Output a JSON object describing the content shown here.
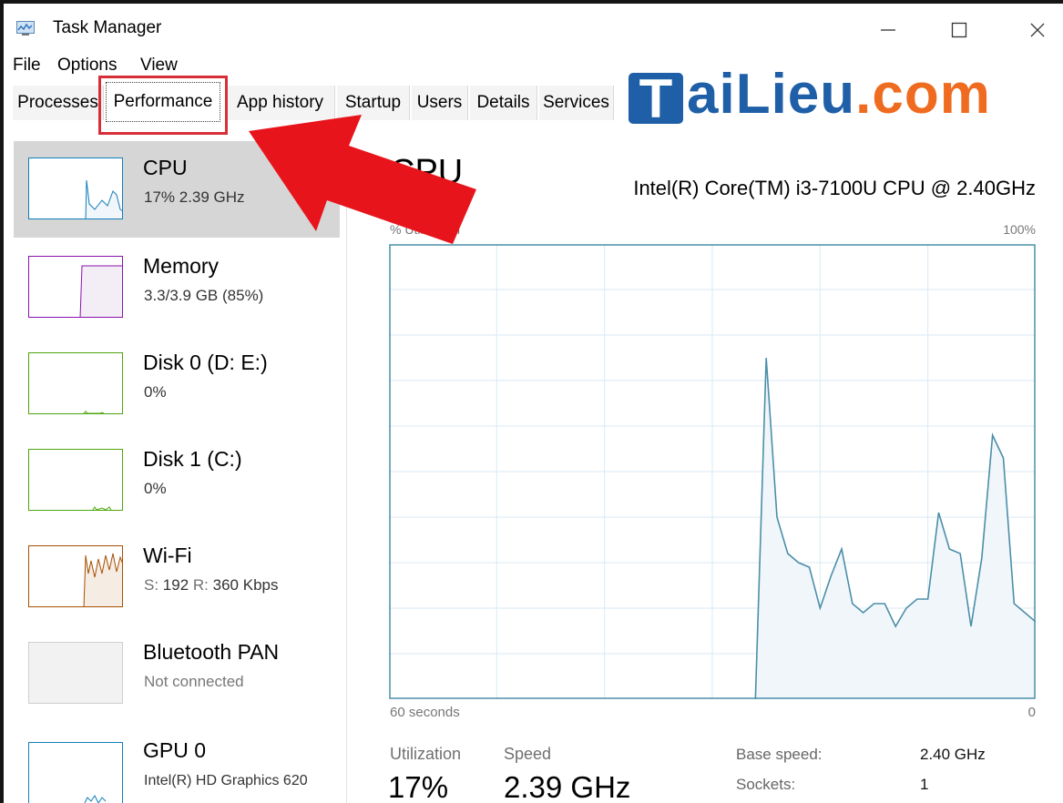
{
  "window": {
    "title": "Task Manager",
    "icons": {
      "app": "task-manager-icon",
      "minimize": "minimize-icon",
      "maximize": "maximize-icon",
      "close": "close-icon"
    }
  },
  "menu": [
    "File",
    "Options",
    "View"
  ],
  "tabs": [
    {
      "label": "Processes",
      "active": false
    },
    {
      "label": "Performance",
      "active": true
    },
    {
      "label": "App history",
      "active": false
    },
    {
      "label": "Startup",
      "active": false
    },
    {
      "label": "Users",
      "active": false
    },
    {
      "label": "Details",
      "active": false
    },
    {
      "label": "Services",
      "active": false
    }
  ],
  "watermark": {
    "text_T": "T",
    "text_blue": "aiLieu",
    "text_orange": ".com"
  },
  "sidebar": {
    "items": [
      {
        "name": "CPU",
        "sub": "17% 2.39 GHz",
        "selected": true,
        "color": "#117dbb"
      },
      {
        "name": "Memory",
        "sub": "3.3/3.9 GB (85%)",
        "selected": false,
        "color": "#8b12ae"
      },
      {
        "name": "Disk 0 (D: E:)",
        "sub": "0%",
        "selected": false,
        "color": "#4da60c"
      },
      {
        "name": "Disk 1 (C:)",
        "sub": "0%",
        "selected": false,
        "color": "#4da60c"
      },
      {
        "name": "Wi-Fi",
        "sub_s_label": "S:",
        "sub_s_value": "192",
        "sub_r_label": "R:",
        "sub_r_value": "360 Kbps",
        "selected": false,
        "color": "#a74f01"
      },
      {
        "name": "Bluetooth PAN",
        "sub": "Not connected",
        "selected": false,
        "color": "#999999"
      },
      {
        "name": "GPU 0",
        "sub": "Intel(R) HD Graphics 620",
        "selected": false,
        "color": "#117dbb"
      }
    ]
  },
  "main": {
    "title": "CPU",
    "model": "Intel(R) Core(TM) i3-7100U CPU @ 2.40GHz",
    "graph_label": "% Utilization",
    "graph_max": "100%",
    "graph_time": "60 seconds",
    "graph_min": "0",
    "stats": {
      "utilization_label": "Utilization",
      "utilization_value": "17%",
      "speed_label": "Speed",
      "speed_value": "2.39 GHz",
      "base_speed_label": "Base speed:",
      "base_speed_value": "2.40 GHz",
      "sockets_label": "Sockets:",
      "sockets_value": "1"
    }
  },
  "chart_data": {
    "type": "area",
    "ylim": [
      0,
      100
    ],
    "x": [
      0,
      1,
      2,
      3,
      4,
      5,
      6,
      7,
      8,
      9,
      10,
      11,
      12,
      13,
      14,
      15,
      16,
      17,
      18,
      19,
      20,
      21,
      22,
      23,
      24,
      25,
      26,
      27,
      28,
      29,
      30,
      31,
      32,
      33,
      34,
      35,
      36,
      37,
      38,
      39,
      40,
      41,
      42,
      43,
      44,
      45,
      46,
      47,
      48,
      49,
      50,
      51,
      52,
      53,
      54,
      55,
      56,
      57,
      58,
      59,
      60
    ],
    "values": [
      null,
      null,
      null,
      null,
      null,
      null,
      null,
      null,
      null,
      null,
      null,
      null,
      null,
      null,
      null,
      null,
      null,
      null,
      null,
      null,
      null,
      null,
      null,
      null,
      null,
      null,
      null,
      null,
      null,
      null,
      null,
      null,
      null,
      null,
      0,
      75,
      40,
      32,
      30,
      29,
      20,
      27,
      33,
      21,
      19,
      21,
      21,
      16,
      20,
      22,
      22,
      41,
      33,
      32,
      16,
      31,
      58,
      53,
      21,
      19,
      17
    ],
    "colors": {
      "line": "#4b8fa9",
      "fill": "#f1f6fa",
      "grid": "#d9eaf4",
      "border": "#4b8fa9"
    }
  }
}
